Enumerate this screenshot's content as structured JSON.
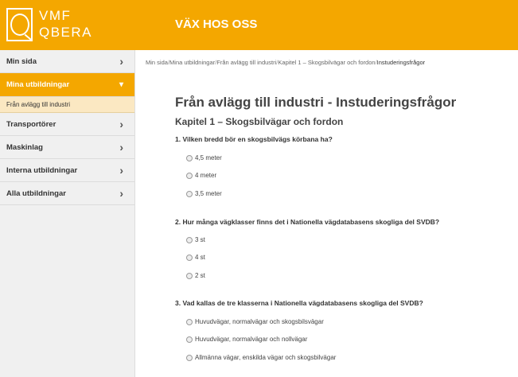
{
  "logo": {
    "line1": "VMF",
    "line2": "QBERA"
  },
  "header": {
    "title": "VÄX HOS OSS"
  },
  "sidebar": {
    "items": [
      {
        "label": "Min sida"
      },
      {
        "label": "Mina utbildningar"
      },
      {
        "label": "Transportörer"
      },
      {
        "label": "Maskinlag"
      },
      {
        "label": "Interna utbildningar"
      },
      {
        "label": "Alla utbildningar"
      }
    ],
    "sub_item": "Från avlägg till industri"
  },
  "breadcrumb": {
    "items": [
      "Min sida",
      "Mina utbildningar",
      "Från avlägg till industri",
      "Kapitel 1 – Skogsbilvägar och fordon",
      "Instuderingsfrågor"
    ],
    "separator": "/"
  },
  "page": {
    "title": "Från avlägg till industri - Instuderingsfrågor",
    "chapter": "Kapitel 1 – Skogsbilvägar och fordon"
  },
  "questions": [
    {
      "text": "1. Vilken bredd bör en skogsbilvägs körbana ha?",
      "options": [
        "4,5 meter",
        "4 meter",
        "3,5 meter"
      ]
    },
    {
      "text": "2. Hur många vägklasser finns det i Nationella vägdatabasens skogliga del SVDB?",
      "options": [
        "3 st",
        "4 st",
        "2 st"
      ]
    },
    {
      "text": "3. Vad kallas de tre klasserna i Nationella vägdatabasens skogliga del SVDB?",
      "options": [
        "Huvudvägar, normalvägar och skogsbilsvägar",
        "Huvudvägar, normalvägar och nollvägar",
        "Allmänna vägar, enskilda vägar och skogsbilvägar"
      ]
    }
  ],
  "colors": {
    "accent": "#f4a700",
    "sub_highlight": "#fbe8c2",
    "sidebar_bg": "#f0f0f0"
  }
}
